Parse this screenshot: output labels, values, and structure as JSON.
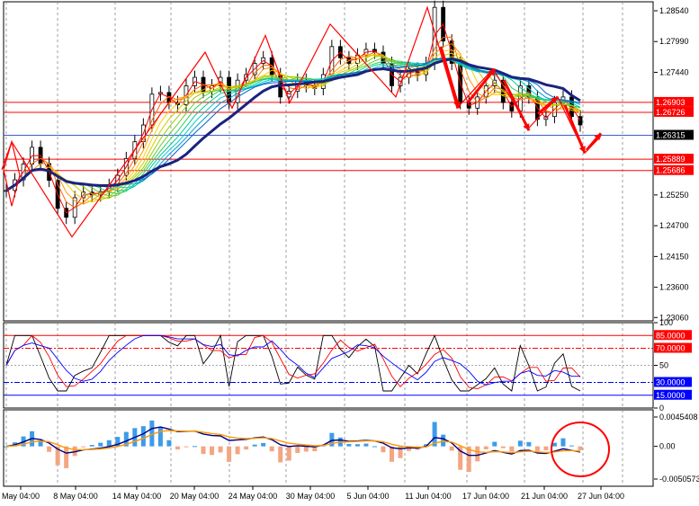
{
  "chart_data": {
    "type": "candlestick",
    "price_panel": {
      "y_ticks": [
        "1.28540",
        "1.27990",
        "1.27440",
        "1.26315",
        "1.25250",
        "1.24700",
        "1.24150",
        "1.23600",
        "1.23060"
      ],
      "ylim": [
        1.23,
        1.287
      ],
      "horizontal_lines": [
        {
          "value": 1.26903,
          "label": "1.26903",
          "color": "#ff0000"
        },
        {
          "value": 1.26726,
          "label": "1.26726",
          "color": "#ff0000"
        },
        {
          "value": 1.26315,
          "label": "1.26315",
          "color": "#000000",
          "style": "current-price"
        },
        {
          "value": 1.25889,
          "label": "1.25889",
          "color": "#ff0000"
        },
        {
          "value": 1.25686,
          "label": "1.25686",
          "color": "#ff0000"
        }
      ],
      "close_series": [
        1.2533,
        1.2552,
        1.258,
        1.261,
        1.2581,
        1.2551,
        1.2501,
        1.2485,
        1.252,
        1.253,
        1.2525,
        1.2531,
        1.2542,
        1.256,
        1.259,
        1.262,
        1.265,
        1.2705,
        1.2708,
        1.269,
        1.2686,
        1.272,
        1.2735,
        1.271,
        1.272,
        1.2735,
        1.269,
        1.273,
        1.274,
        1.276,
        1.277,
        1.274,
        1.27,
        1.271,
        1.273,
        1.272,
        1.2715,
        1.274,
        1.279,
        1.277,
        1.276,
        1.2775,
        1.2785,
        1.278,
        1.276,
        1.272,
        1.2735,
        1.275,
        1.274,
        1.276,
        1.286,
        1.28,
        1.276,
        1.269,
        1.268,
        1.27,
        1.272,
        1.273,
        1.269,
        1.2675,
        1.272,
        1.27,
        1.266,
        1.2665,
        1.269,
        1.27,
        1.2665,
        1.265
      ]
    },
    "rsi_panel": {
      "y_ticks": [
        "100",
        "50",
        "0"
      ],
      "levels": [
        {
          "value": 85,
          "label": "85.0000",
          "color": "#ff0000"
        },
        {
          "value": 70,
          "label": "70.0000",
          "color": "#ff0000"
        },
        {
          "value": 30,
          "label": "30.0000",
          "color": "#0000ff"
        },
        {
          "value": 15,
          "label": "15.0000",
          "color": "#0000ff"
        }
      ]
    },
    "macd_panel": {
      "y_ticks": [
        "0.0045408",
        "0.00",
        "-0.0050573"
      ]
    },
    "x_tick_labels": [
      "May 04:00",
      "8 May 04:00",
      "14 May 04:00",
      "20 May 04:00",
      "24 May 04:00",
      "30 May 04:00",
      "5 Jun 04:00",
      "11 Jun 04:00",
      "17 Jun 04:00",
      "21 Jun 04:00",
      "27 Jun 04:00"
    ]
  }
}
